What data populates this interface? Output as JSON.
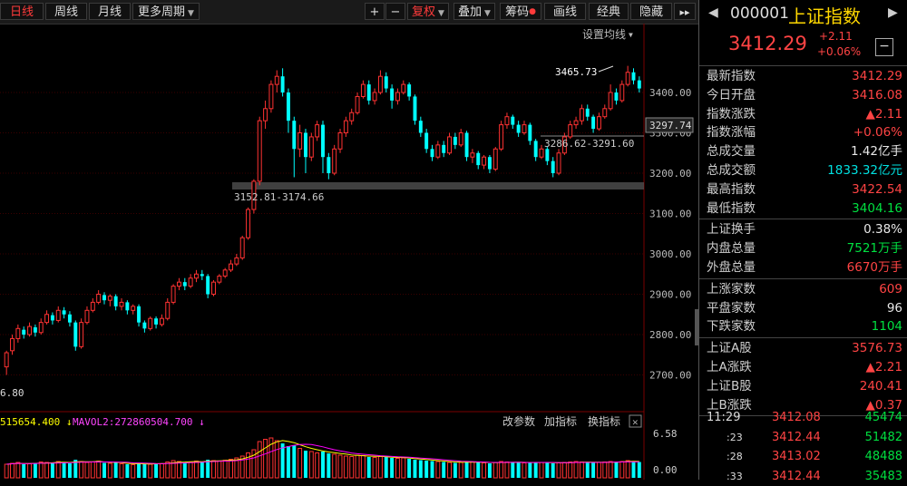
{
  "toolbar": {
    "tabs": [
      "日线",
      "周线",
      "月线",
      "更多周期"
    ],
    "plus": "+",
    "minus": "−",
    "fuquan": "复权",
    "diejia": "叠加",
    "chouma": "筹码",
    "huaxian": "画线",
    "jingdian": "经典",
    "yincang": "隐藏",
    "more": "▸▸"
  },
  "chart": {
    "setting_label": "设置均线",
    "price_ticks": [
      "3400.00",
      "3300.00",
      "3200.00",
      "3100.00",
      "3000.00",
      "2900.00",
      "2800.00",
      "2700.00"
    ],
    "last_price_tag": "3297.74",
    "high_label": "3465.73",
    "zone1_label": "3286.62-3291.60",
    "zone2_label": "3152.81-3174.66",
    "left_label": "6.80",
    "vol_legend_a": "515654.400 ↓",
    "vol_legend_b": "MAVOL2:272860504.700 ↓",
    "vol_btns": [
      "改参数",
      "加指标",
      "换指标"
    ],
    "vol_ticks": [
      "6.58",
      "0.00"
    ],
    "candles": [
      [
        2720,
        2755,
        2700,
        2760
      ],
      [
        2760,
        2790,
        2750,
        2800
      ],
      [
        2790,
        2815,
        2780,
        2825
      ],
      [
        2812,
        2800,
        2790,
        2820
      ],
      [
        2800,
        2820,
        2795,
        2830
      ],
      [
        2818,
        2805,
        2795,
        2825
      ],
      [
        2805,
        2830,
        2800,
        2840
      ],
      [
        2830,
        2850,
        2825,
        2860
      ],
      [
        2848,
        2835,
        2825,
        2855
      ],
      [
        2835,
        2860,
        2830,
        2870
      ],
      [
        2860,
        2850,
        2840,
        2868
      ],
      [
        2850,
        2830,
        2820,
        2858
      ],
      [
        2830,
        2770,
        2760,
        2835
      ],
      [
        2770,
        2830,
        2765,
        2840
      ],
      [
        2830,
        2860,
        2825,
        2870
      ],
      [
        2860,
        2880,
        2855,
        2890
      ],
      [
        2880,
        2900,
        2875,
        2910
      ],
      [
        2898,
        2885,
        2875,
        2905
      ],
      [
        2885,
        2895,
        2870,
        2900
      ],
      [
        2895,
        2870,
        2860,
        2900
      ],
      [
        2870,
        2880,
        2860,
        2890
      ],
      [
        2880,
        2860,
        2850,
        2885
      ],
      [
        2860,
        2870,
        2850,
        2875
      ],
      [
        2870,
        2830,
        2820,
        2875
      ],
      [
        2830,
        2815,
        2805,
        2835
      ],
      [
        2815,
        2840,
        2810,
        2845
      ],
      [
        2840,
        2825,
        2815,
        2845
      ],
      [
        2825,
        2840,
        2820,
        2850
      ],
      [
        2840,
        2880,
        2835,
        2890
      ],
      [
        2880,
        2920,
        2875,
        2925
      ],
      [
        2920,
        2930,
        2910,
        2940
      ],
      [
        2930,
        2920,
        2910,
        2940
      ],
      [
        2920,
        2940,
        2915,
        2950
      ],
      [
        2940,
        2950,
        2930,
        2960
      ],
      [
        2950,
        2945,
        2935,
        2960
      ],
      [
        2945,
        2900,
        2890,
        2950
      ],
      [
        2900,
        2930,
        2895,
        2935
      ],
      [
        2930,
        2945,
        2925,
        2950
      ],
      [
        2945,
        2960,
        2940,
        2965
      ],
      [
        2960,
        2975,
        2955,
        2985
      ],
      [
        2975,
        2990,
        2970,
        3000
      ],
      [
        2990,
        3040,
        2985,
        3045
      ],
      [
        3040,
        3110,
        3035,
        3115
      ],
      [
        3110,
        3180,
        3100,
        3185
      ],
      [
        3180,
        3330,
        3170,
        3340
      ],
      [
        3330,
        3360,
        3310,
        3380
      ],
      [
        3360,
        3420,
        3350,
        3430
      ],
      [
        3420,
        3440,
        3400,
        3455
      ],
      [
        3440,
        3400,
        3390,
        3460
      ],
      [
        3400,
        3330,
        3300,
        3410
      ],
      [
        3330,
        3260,
        3190,
        3340
      ],
      [
        3260,
        3300,
        3240,
        3320
      ],
      [
        3300,
        3240,
        3200,
        3310
      ],
      [
        3240,
        3290,
        3230,
        3300
      ],
      [
        3290,
        3320,
        3280,
        3330
      ],
      [
        3320,
        3240,
        3200,
        3330
      ],
      [
        3240,
        3200,
        3185,
        3250
      ],
      [
        3200,
        3260,
        3195,
        3270
      ],
      [
        3260,
        3300,
        3250,
        3310
      ],
      [
        3300,
        3330,
        3290,
        3340
      ],
      [
        3330,
        3350,
        3320,
        3360
      ],
      [
        3350,
        3390,
        3345,
        3400
      ],
      [
        3390,
        3420,
        3385,
        3430
      ],
      [
        3420,
        3380,
        3370,
        3430
      ],
      [
        3380,
        3400,
        3370,
        3410
      ],
      [
        3400,
        3440,
        3395,
        3455
      ],
      [
        3440,
        3410,
        3400,
        3450
      ],
      [
        3410,
        3380,
        3360,
        3420
      ],
      [
        3380,
        3400,
        3370,
        3410
      ],
      [
        3400,
        3420,
        3395,
        3430
      ],
      [
        3420,
        3390,
        3380,
        3425
      ],
      [
        3390,
        3330,
        3320,
        3395
      ],
      [
        3330,
        3300,
        3290,
        3340
      ],
      [
        3300,
        3260,
        3250,
        3310
      ],
      [
        3260,
        3240,
        3230,
        3270
      ],
      [
        3240,
        3270,
        3235,
        3280
      ],
      [
        3270,
        3250,
        3240,
        3280
      ],
      [
        3250,
        3290,
        3245,
        3300
      ],
      [
        3290,
        3270,
        3260,
        3300
      ],
      [
        3270,
        3300,
        3265,
        3310
      ],
      [
        3300,
        3240,
        3230,
        3305
      ],
      [
        3240,
        3250,
        3225,
        3260
      ],
      [
        3250,
        3220,
        3210,
        3255
      ],
      [
        3220,
        3240,
        3210,
        3245
      ],
      [
        3240,
        3210,
        3200,
        3245
      ],
      [
        3210,
        3260,
        3205,
        3265
      ],
      [
        3260,
        3320,
        3255,
        3330
      ],
      [
        3320,
        3340,
        3310,
        3350
      ],
      [
        3340,
        3320,
        3310,
        3345
      ],
      [
        3320,
        3300,
        3290,
        3330
      ],
      [
        3300,
        3320,
        3295,
        3330
      ],
      [
        3320,
        3280,
        3270,
        3325
      ],
      [
        3280,
        3240,
        3230,
        3285
      ],
      [
        3240,
        3260,
        3235,
        3270
      ],
      [
        3260,
        3230,
        3220,
        3265
      ],
      [
        3230,
        3200,
        3190,
        3240
      ],
      [
        3200,
        3250,
        3195,
        3260
      ],
      [
        3250,
        3290,
        3245,
        3300
      ],
      [
        3290,
        3320,
        3285,
        3330
      ],
      [
        3320,
        3330,
        3310,
        3340
      ],
      [
        3330,
        3360,
        3320,
        3370
      ],
      [
        3360,
        3340,
        3330,
        3370
      ],
      [
        3340,
        3310,
        3300,
        3345
      ],
      [
        3310,
        3340,
        3305,
        3350
      ],
      [
        3340,
        3360,
        3335,
        3370
      ],
      [
        3360,
        3400,
        3355,
        3420
      ],
      [
        3400,
        3380,
        3370,
        3410
      ],
      [
        3380,
        3420,
        3375,
        3430
      ],
      [
        3420,
        3450,
        3415,
        3466
      ],
      [
        3450,
        3430,
        3420,
        3460
      ],
      [
        3430,
        3410,
        3400,
        3440
      ]
    ],
    "volumes": [
      30,
      32,
      34,
      30,
      31,
      33,
      35,
      34,
      33,
      36,
      35,
      32,
      40,
      36,
      34,
      35,
      37,
      33,
      32,
      34,
      31,
      30,
      29,
      33,
      31,
      30,
      32,
      31,
      35,
      38,
      36,
      34,
      35,
      37,
      36,
      40,
      38,
      37,
      39,
      41,
      44,
      48,
      55,
      62,
      80,
      85,
      88,
      82,
      76,
      70,
      72,
      65,
      60,
      58,
      55,
      58,
      54,
      52,
      50,
      48,
      47,
      50,
      49,
      46,
      45,
      47,
      46,
      44,
      43,
      44,
      42,
      40,
      39,
      38,
      37,
      36,
      35,
      34,
      33,
      34,
      36,
      35,
      34,
      33,
      32,
      34,
      36,
      35,
      34,
      33,
      33,
      34,
      35,
      34,
      33,
      32,
      33,
      34,
      35,
      36,
      35,
      34,
      33,
      34,
      35,
      36,
      35,
      36,
      38,
      37,
      35
    ]
  },
  "quote": {
    "code": "000001",
    "name": "上证指数",
    "price": "3412.29",
    "change": "+2.11",
    "change_pct": "+0.06%",
    "minus_btn": "−",
    "rows1": [
      {
        "label": "最新指数",
        "value": "3412.29",
        "color": "red"
      },
      {
        "label": "今日开盘",
        "value": "3416.08",
        "color": "red"
      },
      {
        "label": "指数涨跌",
        "value": "▲2.11",
        "color": "red"
      },
      {
        "label": "指数涨幅",
        "value": "+0.06%",
        "color": "red"
      },
      {
        "label": "总成交量",
        "value": "1.42亿手",
        "color": "white"
      },
      {
        "label": "总成交额",
        "value": "1833.32亿元",
        "color": "cyan"
      },
      {
        "label": "最高指数",
        "value": "3422.54",
        "color": "red"
      },
      {
        "label": "最低指数",
        "value": "3404.16",
        "color": "green"
      }
    ],
    "rows2": [
      {
        "label": "上证换手",
        "value": "0.38%",
        "color": "white"
      },
      {
        "label": "内盘总量",
        "value": "7521万手",
        "color": "green"
      },
      {
        "label": "外盘总量",
        "value": "6670万手",
        "color": "red"
      }
    ],
    "rows3": [
      {
        "label": "上涨家数",
        "value": "609",
        "color": "red"
      },
      {
        "label": "平盘家数",
        "value": "96",
        "color": "white"
      },
      {
        "label": "下跌家数",
        "value": "1104",
        "color": "green"
      }
    ],
    "rows4": [
      {
        "label": "上证A股",
        "value": "3576.73",
        "color": "red"
      },
      {
        "label": "上A涨跌",
        "value": "▲2.21",
        "color": "red"
      },
      {
        "label": "上证B股",
        "value": "240.41",
        "color": "red"
      },
      {
        "label": "上B涨跌",
        "value": "▲0.37",
        "color": "red"
      }
    ],
    "ticks": [
      {
        "time": "11:29",
        "price": "3412.08",
        "vol": "45474"
      },
      {
        "time": ":23",
        "price": "3412.44",
        "vol": "51482"
      },
      {
        "time": ":28",
        "price": "3413.02",
        "vol": "48488"
      },
      {
        "time": ":33",
        "price": "3412.44",
        "vol": "35483"
      }
    ]
  }
}
